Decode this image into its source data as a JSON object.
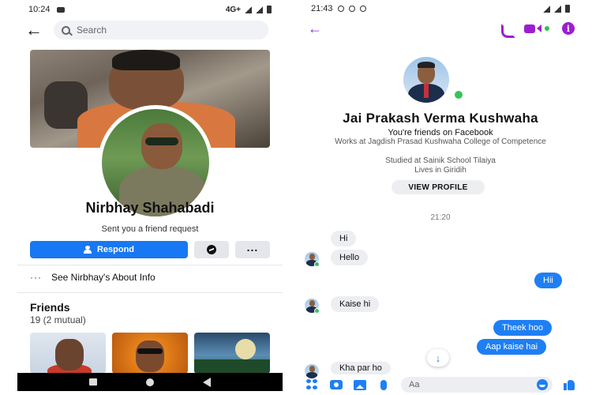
{
  "left": {
    "status": {
      "time": "10:24",
      "network": "4G+"
    },
    "search": {
      "placeholder": "Search"
    },
    "profile": {
      "name": "Nirbhay Shahabadi",
      "request_text": "Sent you a friend request",
      "respond_label": "Respond",
      "about_label": "See Nirbhay's About Info"
    },
    "friends": {
      "title": "Friends",
      "count": "19 (2 mutual)"
    }
  },
  "right": {
    "status": {
      "time": "21:43"
    },
    "contact": {
      "name": "Jai Prakash Verma Kushwaha",
      "friends_line": "You're friends on Facebook",
      "work_line": "Works at Jagdish Prasad Kushwaha College of Competence",
      "study_line": "Studied at Sainik School Tilaiya",
      "lives_line": "Lives in Giridih",
      "view_profile_label": "VIEW PROFILE"
    },
    "thread": {
      "timestamp": "21:20",
      "messages": [
        {
          "from": "them",
          "text": "Hi"
        },
        {
          "from": "them",
          "text": "Hello"
        },
        {
          "from": "me",
          "text": "Hii"
        },
        {
          "from": "them",
          "text": "Kaise hi"
        },
        {
          "from": "me",
          "text": "Theek hoo"
        },
        {
          "from": "me",
          "text": "Aap kaise hai"
        },
        {
          "from": "them",
          "text": "Kha par ho"
        }
      ]
    },
    "composer": {
      "placeholder": "Aa"
    }
  },
  "colors": {
    "facebook_blue": "#1877f2",
    "messenger_purple": "#9b1fd1",
    "messenger_blue": "#1e7ff4",
    "online_green": "#37c35b"
  },
  "icons": [
    "back-arrow-icon",
    "search-icon",
    "person-add-icon",
    "messenger-icon",
    "more-dots-icon",
    "phone-icon",
    "video-icon",
    "info-icon",
    "menu-icon",
    "camera-icon",
    "image-icon",
    "mic-icon",
    "emoji-icon",
    "like-icon",
    "scroll-down-icon"
  ]
}
